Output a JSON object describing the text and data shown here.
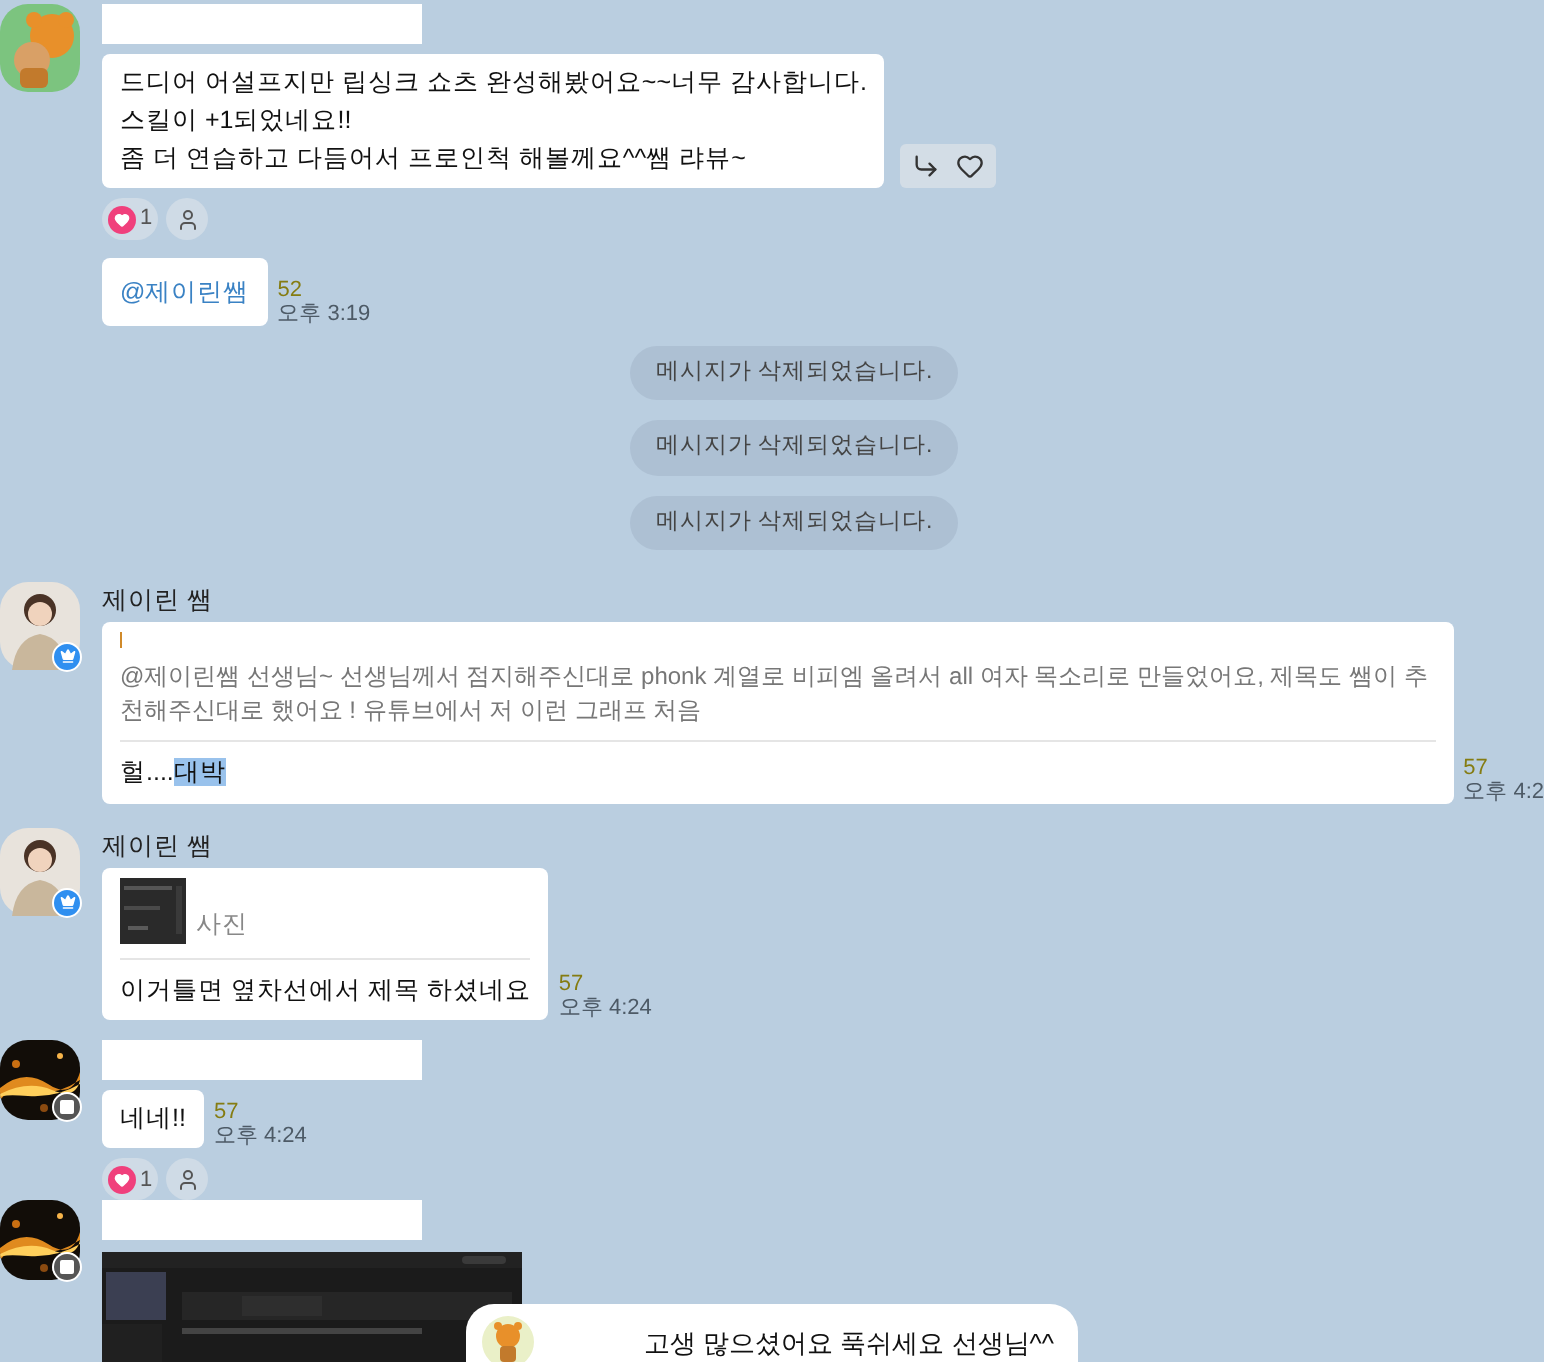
{
  "chat": [
    {
      "kind": "message",
      "avatar": {
        "kind": "character"
      },
      "name_hidden": true,
      "lines": [
        "드디어 어설프지만 립싱크 쇼츠 완성해봤어요~~너무 감사합니다.",
        "스킬이 +1되었네요!!",
        "좀 더 연습하고 다듬어서 프로인척 해볼께요^^쌤 랴뷰~"
      ],
      "hover_actions": true,
      "reactions": {
        "hearts": "1"
      }
    },
    {
      "kind": "mention",
      "text": "@제이린쌤",
      "unread": "52",
      "time": "오후 3:19"
    },
    {
      "kind": "notice",
      "text": "메시지가 삭제되었습니다."
    },
    {
      "kind": "notice",
      "text": "메시지가 삭제되었습니다."
    },
    {
      "kind": "notice",
      "text": "메시지가 삭제되었습니다."
    },
    {
      "kind": "reply",
      "avatar": {
        "kind": "person",
        "badge": {
          "kind": "crown"
        }
      },
      "name": "제이린 쌤",
      "quote": "@제이린쌤 선생님~ 선생님께서 점지해주신대로 phonk 계열로 비피엠 올려서 all 여자 목소리로 만들었어요, 제목도 쌤이 추천해주신대로 했어요 ! 유튜브에서 저 이런 그래프 처음",
      "reply_parts": [
        {
          "text": "헐....",
          "selected": false
        },
        {
          "text": "대박",
          "selected": true
        }
      ],
      "unread": "57",
      "time": "오후 4:2"
    },
    {
      "kind": "photo_reply",
      "avatar": {
        "kind": "person",
        "badge": {
          "kind": "crown"
        }
      },
      "name": "제이린 쌤",
      "quote": "사진",
      "reply_parts": [
        {
          "text": "이거틀면 옆차선에서 제목 하셨네요",
          "selected": false
        }
      ],
      "unread": "57",
      "time": "오후 4:24"
    },
    {
      "kind": "message",
      "avatar": {
        "kind": "picture",
        "badge": {
          "kind": "board"
        }
      },
      "name_hidden": true,
      "lines": [
        "네네!!"
      ],
      "unread": "57",
      "time": "오후 4:24",
      "reactions": {
        "hearts": "1"
      }
    },
    {
      "avatar": {
        "kind": "picture",
        "badge": {
          "kind": "board"
        }
      },
      "name_hidden": true
    }
  ],
  "toast": {
    "avatar": {
      "kind": "character"
    },
    "text": "고생 많으셨어요 푹쉬세요 선생님^^"
  }
}
